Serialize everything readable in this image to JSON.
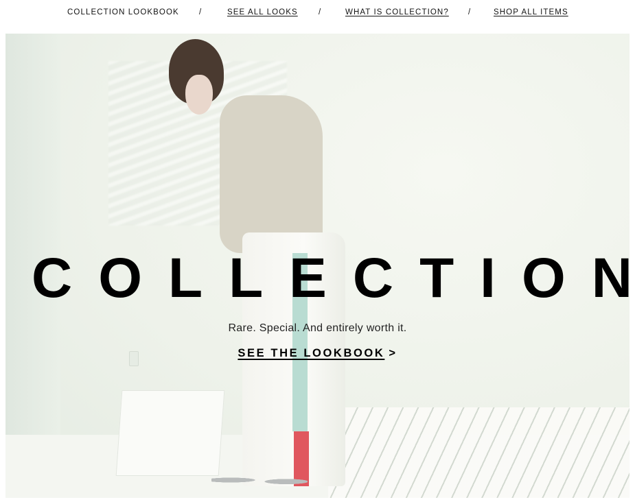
{
  "nav": {
    "items": [
      {
        "label": "COLLECTION LOOKBOOK"
      },
      {
        "label": "SEE ALL LOOKS"
      },
      {
        "label": "WHAT IS COLLECTION?"
      },
      {
        "label": "SHOP ALL ITEMS"
      }
    ],
    "separator": "/"
  },
  "hero": {
    "headline": "COLLECTION",
    "tagline": "Rare. Special. And entirely worth it.",
    "cta_label": "SEE THE LOOKBOOK",
    "cta_arrow": ">"
  },
  "colors": {
    "background": "#ffffff",
    "hero_tint": "#eef2ea",
    "text": "#000000",
    "stripe_mint": "#b9dcd2",
    "stripe_red": "#e0575e"
  }
}
